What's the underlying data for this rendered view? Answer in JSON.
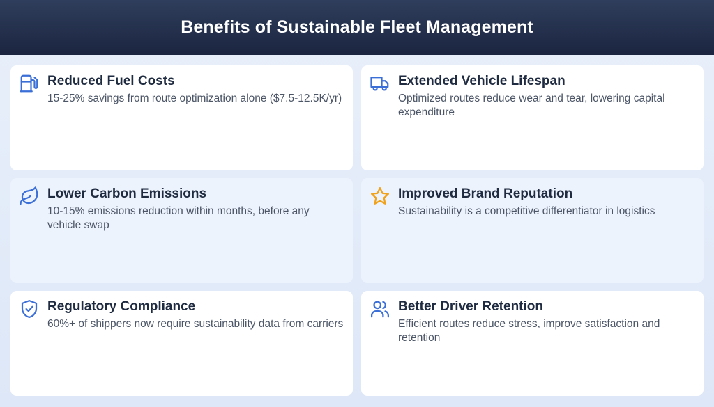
{
  "header": {
    "title": "Benefits of Sustainable Fleet Management"
  },
  "colors": {
    "header": "#1f2a44",
    "icon_blue": "#3b6fd8",
    "icon_gold": "#f0a21a"
  },
  "cards": [
    {
      "icon": "fuel-pump-icon",
      "title": "Reduced Fuel Costs",
      "description": "15-25% savings from route optimization alone ($7.5-12.5K/yr)"
    },
    {
      "icon": "truck-icon",
      "title": "Extended Vehicle Lifespan",
      "description": "Optimized routes reduce wear and tear, lowering capital expenditure"
    },
    {
      "icon": "leaf-icon",
      "title": "Lower Carbon Emissions",
      "description": "10-15% emissions reduction within months, before any vehicle swap"
    },
    {
      "icon": "star-icon",
      "title": "Improved Brand Reputation",
      "description": "Sustainability is a competitive differentiator in logistics"
    },
    {
      "icon": "shield-check-icon",
      "title": "Regulatory Compliance",
      "description": "60%+ of shippers now require sustainability data from carriers"
    },
    {
      "icon": "users-icon",
      "title": "Better Driver Retention",
      "description": "Efficient routes reduce stress, improve satisfaction and retention"
    }
  ]
}
